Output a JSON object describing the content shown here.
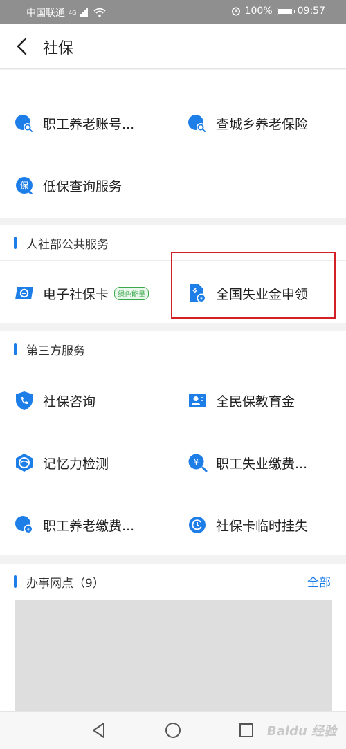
{
  "status_bar": {
    "carrier": "中国联通",
    "network": "4G",
    "battery": "100%",
    "time": "09:57"
  },
  "header": {
    "title": "社保"
  },
  "top_services": [
    {
      "label": "职工养老账号...",
      "icon": "pension-search-icon"
    },
    {
      "label": "查城乡养老保险",
      "icon": "pension-search-icon"
    },
    {
      "label": "低保查询服务",
      "icon": "subsistence-allowance-icon"
    }
  ],
  "hrss_section": {
    "title": "人社部公共服务",
    "items": [
      {
        "label": "电子社保卡",
        "badge": "绿色能量",
        "icon": "e-social-card-icon"
      },
      {
        "label": "全国失业金申领",
        "icon": "unemployment-benefit-icon"
      }
    ]
  },
  "third_party_section": {
    "title": "第三方服务",
    "items": [
      {
        "label": "社保咨询",
        "icon": "shield-phone-icon"
      },
      {
        "label": "全民保教育金",
        "icon": "education-fund-icon"
      },
      {
        "label": "记忆力检测",
        "icon": "memory-test-icon"
      },
      {
        "label": "职工失业缴费...",
        "icon": "yen-search-icon"
      },
      {
        "label": "职工养老缴费...",
        "icon": "pension-payment-icon"
      },
      {
        "label": "社保卡临时挂失",
        "icon": "card-report-loss-icon"
      }
    ]
  },
  "offices_section": {
    "title": "办事网点（9）",
    "more": "全部"
  },
  "bottom_nav": {
    "watermark": "Baidu 经验"
  },
  "colors": {
    "accent": "#1e7ee8",
    "highlight": "#d32027",
    "badge_green": "#3aa84a",
    "status_bar": "#8f8f8f"
  }
}
